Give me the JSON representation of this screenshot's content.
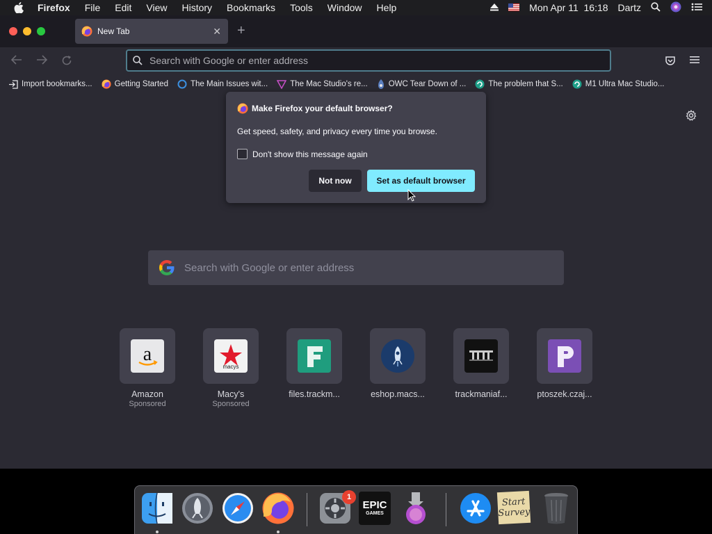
{
  "menubar": {
    "app_name": "Firefox",
    "items": [
      "File",
      "Edit",
      "View",
      "History",
      "Bookmarks",
      "Tools",
      "Window",
      "Help"
    ],
    "clock": "Mon Apr 11  16:18",
    "user": "Dartz"
  },
  "tab": {
    "title": "New Tab",
    "close_glyph": "✕",
    "new_tab_glyph": "+"
  },
  "urlbar": {
    "placeholder": "Search with Google or enter address"
  },
  "bookmarks": [
    {
      "label": "Import bookmarks...",
      "icon": "import-icon"
    },
    {
      "label": "Getting Started",
      "icon": "firefox-icon"
    },
    {
      "label": "The Main Issues wit...",
      "icon": "circle-icon"
    },
    {
      "label": "The Mac Studio's re...",
      "icon": "triangle-icon"
    },
    {
      "label": "OWC Tear Down of ...",
      "icon": "owc-icon"
    },
    {
      "label": "The problem that S...",
      "icon": "swirl-icon"
    },
    {
      "label": "M1 Ultra Mac Studio...",
      "icon": "swirl-icon"
    }
  ],
  "popup": {
    "title": "Make Firefox your default browser?",
    "description": "Get speed, safety, and privacy every time you browse.",
    "checkbox_label": "Don't show this message again",
    "checkbox_checked": false,
    "not_now_label": "Not now",
    "set_default_label": "Set as default browser"
  },
  "search": {
    "placeholder": "Search with Google or enter address"
  },
  "top_sites": [
    {
      "label": "Amazon",
      "sponsored": "Sponsored",
      "icon": "amazon-icon"
    },
    {
      "label": "Macy's",
      "sponsored": "Sponsored",
      "icon": "macys-icon"
    },
    {
      "label": "files.trackm...",
      "sponsored": "",
      "icon": "f-letter-icon"
    },
    {
      "label": "eshop.macs...",
      "sponsored": "",
      "icon": "rocket-icon"
    },
    {
      "label": "trackmaniaf...",
      "sponsored": "",
      "icon": "tm-icon"
    },
    {
      "label": "ptoszek.czaj...",
      "sponsored": "",
      "icon": "p-letter-icon"
    }
  ],
  "dock": {
    "items": [
      "finder-icon",
      "launchpad-icon",
      "safari-icon",
      "firefox-icon",
      "system-preferences-icon",
      "epic-games-icon",
      "installer-icon",
      "app-store-icon",
      "stickies-icon",
      "trash-icon"
    ],
    "system_preferences_badge": "1",
    "epic_label": "EPIC",
    "epic_sub": "GAMES",
    "stickies_text": "Start Survey"
  },
  "colors": {
    "accent": "#80ebff",
    "window_bg": "#2b2a33",
    "tab_bg": "#42414d"
  }
}
